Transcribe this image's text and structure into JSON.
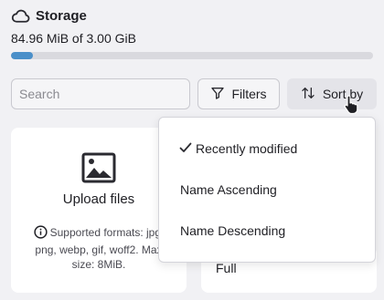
{
  "storage": {
    "title": "Storage",
    "usage_text": "84.96 MiB of 3.00 GiB",
    "usage_fraction": 0.0277,
    "bar_color": "#4a8fc9",
    "icon": "cloud-icon"
  },
  "toolbar": {
    "search_placeholder": "Search",
    "filters_label": "Filters",
    "filters_icon": "filter-icon",
    "sort_label": "Sort by",
    "sort_icon": "sort-arrows-icon"
  },
  "upload_card": {
    "label": "Upload files",
    "icon": "image-icon",
    "note_lines": [
      "Supported formats: jpg,",
      "png, webp, gif, woff2. Max",
      "size: 8MiB."
    ]
  },
  "file_card": {
    "label": "Full"
  },
  "sort_menu": {
    "items": [
      {
        "label": "Recently modified",
        "selected": true
      },
      {
        "label": "Name Ascending",
        "selected": false
      },
      {
        "label": "Name Descending",
        "selected": false
      }
    ]
  }
}
